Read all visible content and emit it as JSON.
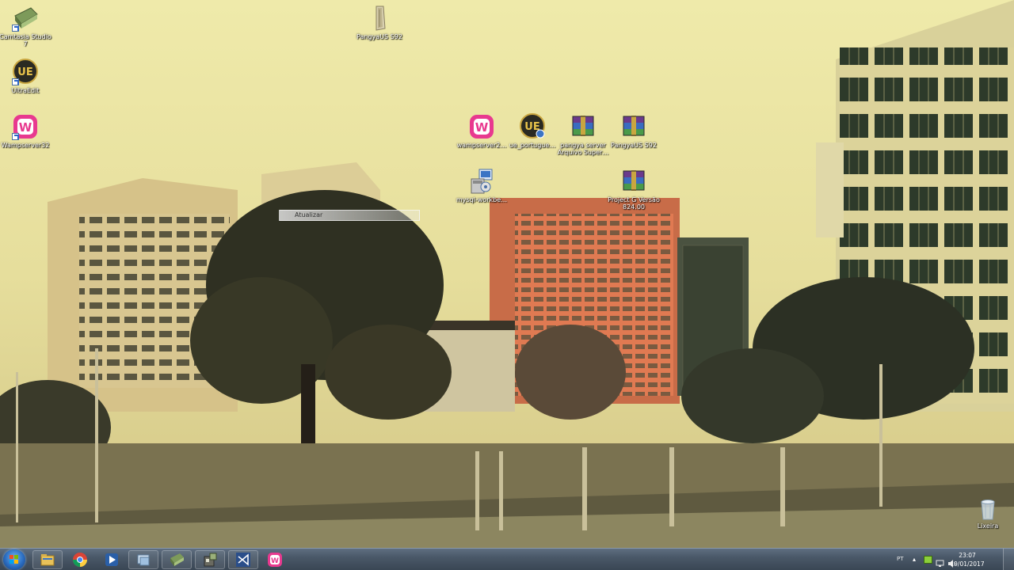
{
  "desktop": {
    "icons": [
      {
        "id": "camtasia",
        "label": "Camtasia Studio 7",
        "icon": "camtasia-icon"
      },
      {
        "id": "ultraedit",
        "label": "UltraEdit",
        "icon": "ultraedit-icon"
      },
      {
        "id": "wampserver",
        "label": "Wampserver32",
        "icon": "wampserver-icon"
      },
      {
        "id": "pangya-folder",
        "label": "PangyaUS S92",
        "icon": "folder-icon"
      },
      {
        "id": "wampserver-installer",
        "label": "wampserver2…",
        "icon": "wampserver-icon"
      },
      {
        "id": "ue-portugues",
        "label": "ue_portugue…",
        "icon": "ultraedit-installer-icon"
      },
      {
        "id": "pangya-server-rar",
        "label": "pangya server Arquivo Super…",
        "icon": "winrar-archive-icon"
      },
      {
        "id": "pangya-rar",
        "label": "PangyaUS S92",
        "icon": "winrar-archive-icon"
      },
      {
        "id": "mysql-workbench",
        "label": "mysql-workbe…",
        "icon": "installer-icon"
      },
      {
        "id": "project-rar",
        "label": "Project G Versão 824.00",
        "icon": "winrar-archive-icon"
      },
      {
        "id": "recycle-bin",
        "label": "Lixeira",
        "icon": "recycle-bin-icon"
      }
    ],
    "context_tip": "Atualizar"
  },
  "taskbar": {
    "items": [
      {
        "id": "explorer",
        "icon": "folder-icon"
      },
      {
        "id": "chrome",
        "icon": "chrome-icon"
      },
      {
        "id": "media-player",
        "icon": "media-player-icon"
      },
      {
        "id": "window-switcher",
        "icon": "window-switcher-icon"
      },
      {
        "id": "camtasia",
        "icon": "camtasia-icon"
      },
      {
        "id": "utility",
        "icon": "utility-icon"
      },
      {
        "id": "visual-studio",
        "icon": "visual-studio-icon"
      },
      {
        "id": "wampserver",
        "icon": "wampserver-icon"
      }
    ],
    "tray": {
      "language": "PT",
      "time": "23:07",
      "date": "19/01/2017"
    }
  },
  "colors": {
    "taskbar": "#4a5868",
    "wallpaper_sky": "#ece8a8",
    "wamp_pink": "#e8398f"
  }
}
